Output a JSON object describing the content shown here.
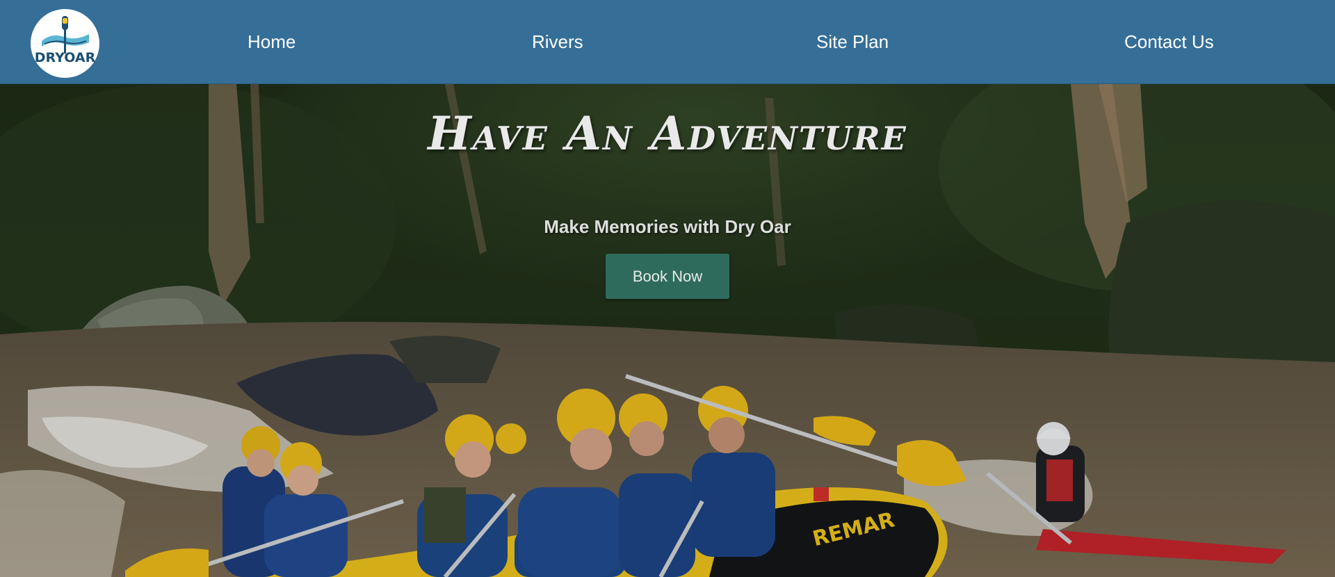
{
  "brand": {
    "logo_text": "DRYOAR",
    "logo_alt": "Dry Oar logo with paddle",
    "colors": {
      "header_bg": "#356f98",
      "button_bg": "#2f6b5c",
      "logo_blue": "#1c4f72",
      "logo_teal": "#5bb5d2"
    }
  },
  "nav": {
    "items": [
      {
        "label": "Home"
      },
      {
        "label": "Rivers"
      },
      {
        "label": "Site Plan"
      },
      {
        "label": "Contact Us"
      }
    ]
  },
  "hero": {
    "headline": "Have An Adventure",
    "subheadline": "Make Memories with Dry Oar",
    "cta_label": "Book Now",
    "raft_brand": "REMAR",
    "image_description": "Group in helmets and life jackets whitewater rafting on a yellow raft in a forest river"
  }
}
